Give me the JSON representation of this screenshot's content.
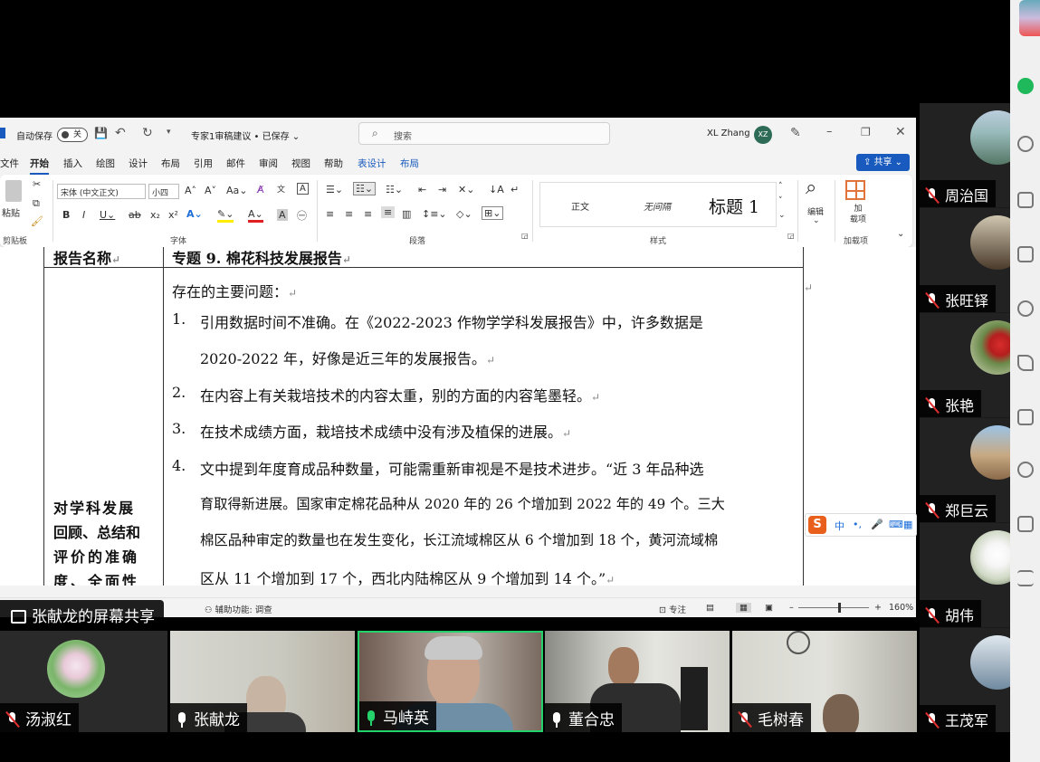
{
  "word": {
    "autosave_label": "自动保存",
    "autosave_state": "关",
    "doc_title": "专家1审稿建议 • 已保存 ⌄",
    "search_placeholder": "搜索",
    "user_name": "XL Zhang",
    "user_initials": "XZ",
    "menu": [
      "文件",
      "开始",
      "插入",
      "绘图",
      "设计",
      "布局",
      "引用",
      "邮件",
      "审阅",
      "视图",
      "帮助",
      "表设计",
      "布局"
    ],
    "share_label": "共享",
    "ribbon": {
      "paste_label": "粘贴",
      "clipboard_label": "剪贴板",
      "font_name": "宋体 (中文正文)",
      "font_size": "小四",
      "font_label": "字体",
      "paragraph_label": "段落",
      "styles_label": "样式",
      "style_normal": "正文",
      "style_nospace": "无间隔",
      "style_heading1": "标题 1",
      "edit_label": "编辑",
      "addins_label": "加载项",
      "addin_btn": "加\n载项"
    },
    "status": {
      "accessibility": "辅助功能: 调查",
      "focus": "专注",
      "zoom": "160%"
    }
  },
  "document": {
    "row1_label": "报告名称",
    "row1_value": "专题 9. 棉花科技发展报告",
    "row2_label_lines": [
      "对学科发展",
      "回顾、总结和",
      "评价的准确",
      "度、全面性"
    ],
    "intro": "存在的主要问题：",
    "items": [
      {
        "num": "1.",
        "lines": [
          "引用数据时间不准确。在《2022-2023 作物学学科发展报告》中，许多数据是",
          "2020-2022 年，好像是近三年的发展报告。"
        ]
      },
      {
        "num": "2.",
        "lines": [
          "在内容上有关栽培技术的内容太重，别的方面的内容笔墨轻。"
        ]
      },
      {
        "num": "3.",
        "lines": [
          "在技术成绩方面，栽培技术成绩中没有涉及植保的进展。"
        ]
      },
      {
        "num": "4.",
        "lines": [
          "文中提到年度育成品种数量，可能需重新审视是不是技术进步。“近 3 年品种选",
          "育取得新进展。国家审定棉花品种从 2020 年的 26 个增加到 2022 年的 49 个。三大",
          "棉区品种审定的数量也在发生变化，长江流域棉区从 6 个增加到 18 个，黄河流域棉",
          "区从 11 个增加到 17 个，西北内陆棉区从 9 个增加到 14 个。”"
        ]
      }
    ],
    "para_mark": "↵"
  },
  "meeting": {
    "share_label": "张献龙的屏幕共享",
    "right_participants": [
      "周治国",
      "张旺铎",
      "张艳",
      "郑巨云",
      "胡伟",
      "王茂军"
    ],
    "bottom_participants": [
      {
        "name": "汤淑红",
        "mic": "muted"
      },
      {
        "name": "张献龙",
        "mic": "on"
      },
      {
        "name": "马峙英",
        "mic": "speaking"
      },
      {
        "name": "董合忠",
        "mic": "on"
      },
      {
        "name": "毛树春",
        "mic": "muted"
      }
    ],
    "accent_speaking": "#25d16b"
  },
  "ime": {
    "lang": "中"
  }
}
